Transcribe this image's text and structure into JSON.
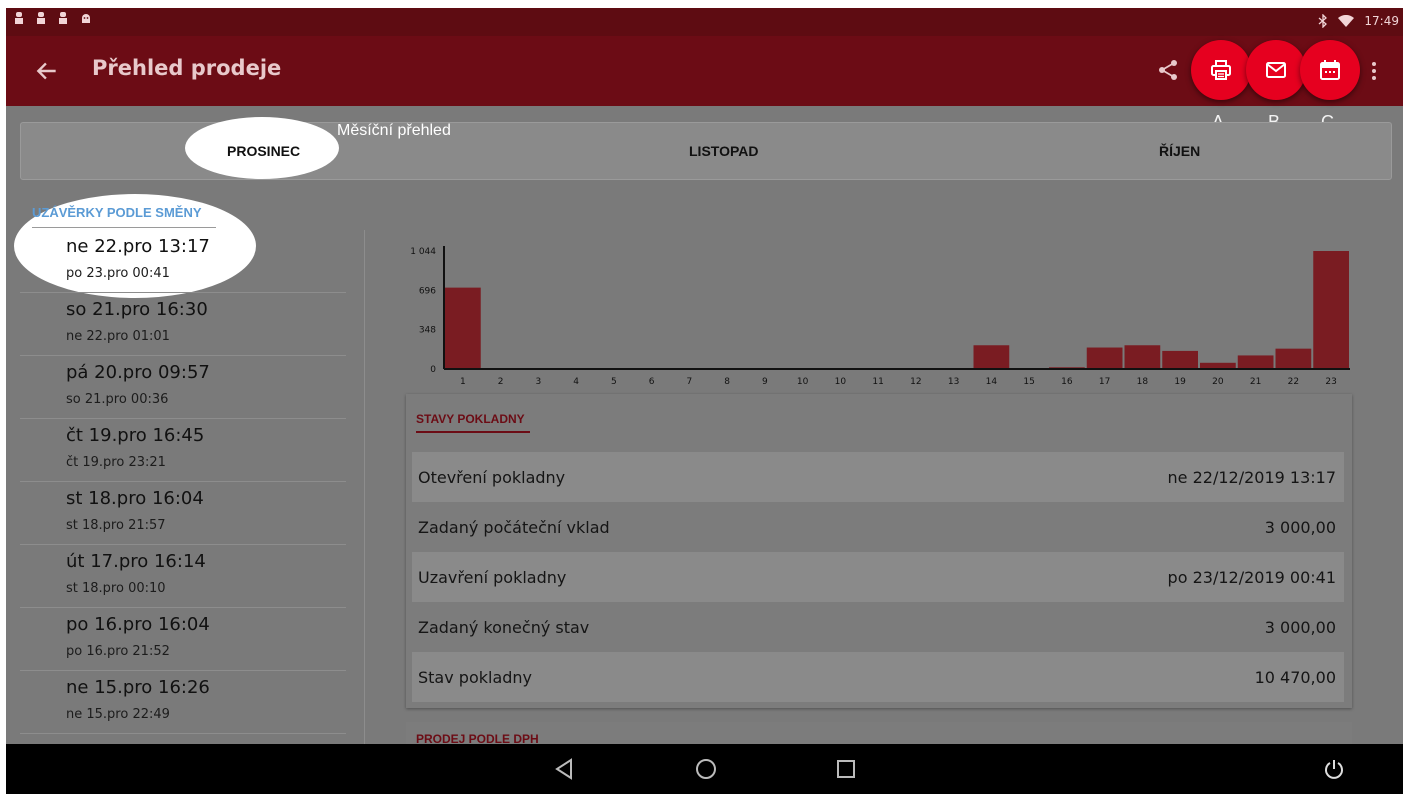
{
  "status_bar": {
    "time": "17:49",
    "left_icons": [
      "notification-icon",
      "notification-icon",
      "notification-icon",
      "android-icon"
    ],
    "right_icons": [
      "bluetooth-icon",
      "wifi-icon"
    ]
  },
  "app_bar": {
    "title": "Přehled prodeje",
    "back_icon": "arrow-left-icon",
    "share_icon": "share-icon",
    "more_icon": "more-vert-icon",
    "fabs": [
      {
        "label": "A",
        "icon": "print-icon"
      },
      {
        "label": "B",
        "icon": "mail-icon"
      },
      {
        "label": "C",
        "icon": "calendar-icon"
      }
    ]
  },
  "annotation": {
    "monthly": "Měsíční přehled"
  },
  "tabs": [
    "PROSINEC",
    "LISTOPAD",
    "ŘÍJEN"
  ],
  "sidebar": {
    "title": "UZÁVĚRKY PODLE SMĚNY",
    "shifts": [
      {
        "start": "ne 22.pro 13:17",
        "end": "po 23.pro 00:41"
      },
      {
        "start": "so 21.pro 16:30",
        "end": "ne 22.pro 01:01"
      },
      {
        "start": "pá 20.pro 09:57",
        "end": "so 21.pro 00:36"
      },
      {
        "start": "čt 19.pro 16:45",
        "end": "čt 19.pro 23:21"
      },
      {
        "start": "st 18.pro 16:04",
        "end": "st 18.pro 21:57"
      },
      {
        "start": "út 17.pro 16:14",
        "end": "st 18.pro 00:10"
      },
      {
        "start": "po 16.pro 16:04",
        "end": "po 16.pro 21:52"
      },
      {
        "start": "ne 15.pro 16:26",
        "end": "ne 15.pro 22:49"
      }
    ]
  },
  "chart_data": {
    "type": "bar",
    "categories": [
      "1",
      "2",
      "3",
      "4",
      "5",
      "6",
      "7",
      "8",
      "9",
      "10",
      "10",
      "11",
      "12",
      "13",
      "14",
      "15",
      "16",
      "17",
      "18",
      "19",
      "20",
      "21",
      "22",
      "23"
    ],
    "values": [
      720,
      0,
      0,
      0,
      0,
      0,
      0,
      0,
      0,
      0,
      0,
      0,
      0,
      0,
      210,
      0,
      15,
      190,
      210,
      160,
      55,
      120,
      180,
      1044
    ],
    "yticks": [
      0,
      348,
      696,
      1044
    ],
    "ytick_labels": [
      "0",
      "348",
      "696",
      "1 044"
    ],
    "ylim": [
      0,
      1044
    ],
    "bar_color": "#7a1c22",
    "axis_color": "#111111"
  },
  "card": {
    "title": "STAVY POKLADNY",
    "rows": [
      {
        "label": "Otevření pokladny",
        "value": "ne 22/12/2019 13:17"
      },
      {
        "label": "Zadaný počáteční vklad",
        "value": "3 000,00"
      },
      {
        "label": "Uzavření pokladny",
        "value": "po 23/12/2019 00:41"
      },
      {
        "label": "Zadaný konečný stav",
        "value": "3 000,00"
      },
      {
        "label": "Stav pokladny",
        "value": "10 470,00"
      }
    ]
  },
  "card2": {
    "title": "PRODEJ PODLE DPH"
  },
  "nav_bar": {
    "icons": [
      "back-triangle-icon",
      "home-circle-icon",
      "recents-square-icon",
      "power-icon"
    ]
  }
}
